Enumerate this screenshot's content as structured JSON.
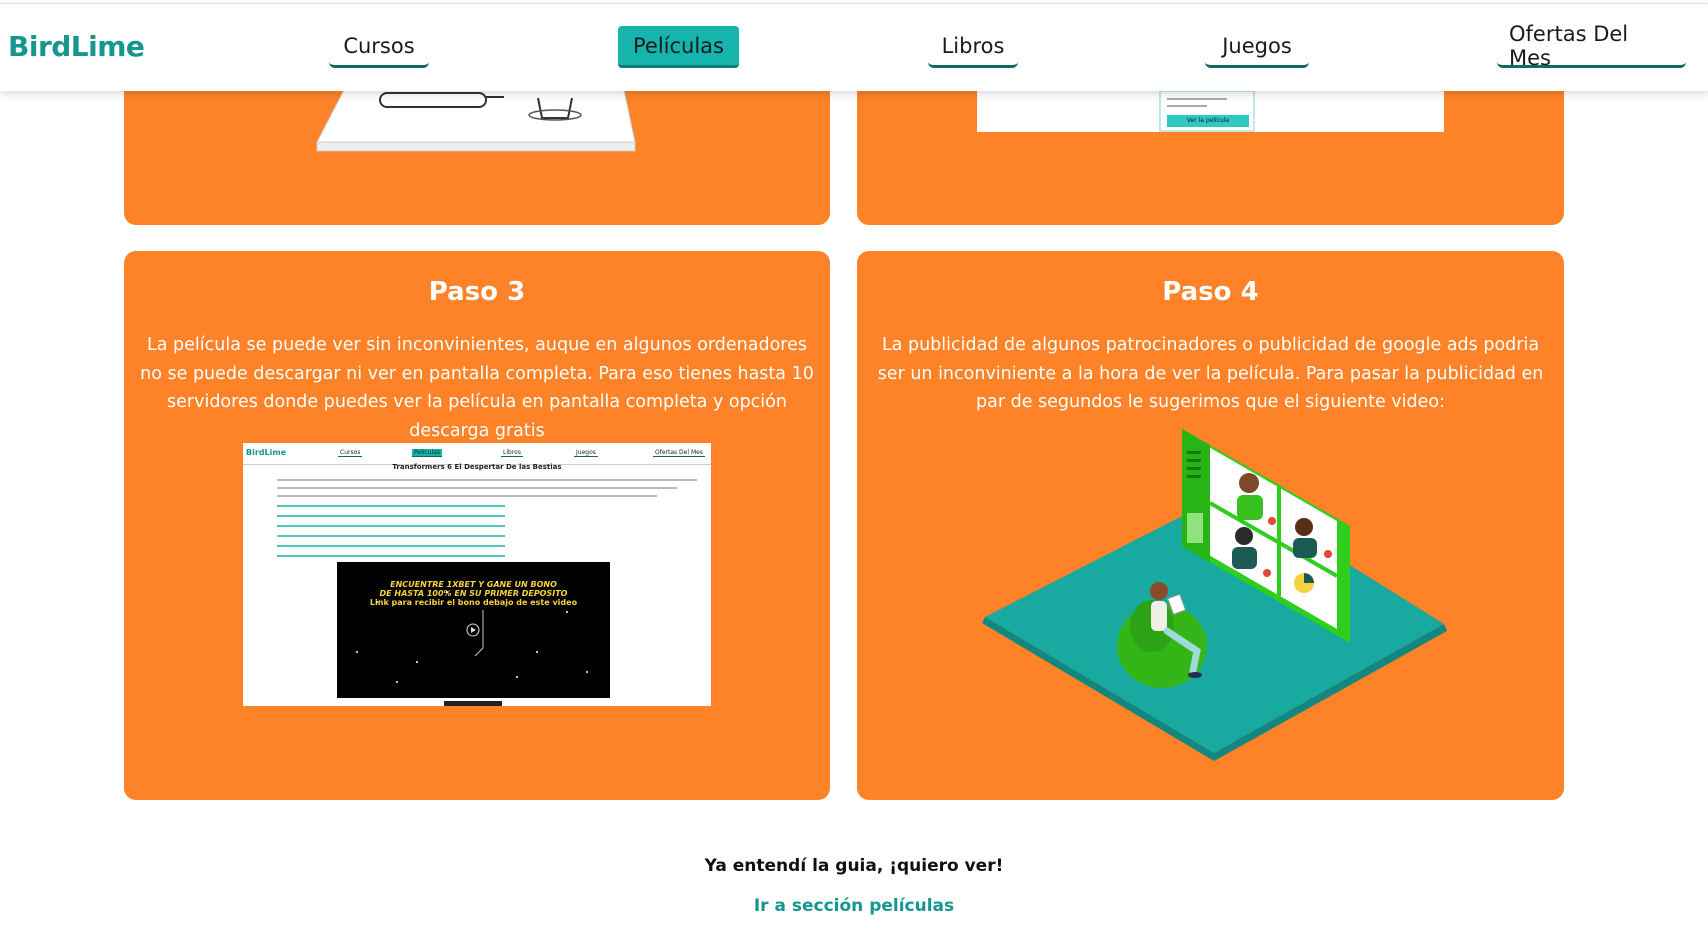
{
  "brand": "BirdLime",
  "nav": {
    "items": [
      {
        "label": "Cursos"
      },
      {
        "label": "Películas"
      },
      {
        "label": "Libros"
      },
      {
        "label": "Juegos"
      },
      {
        "label": "Ofertas Del Mes"
      }
    ],
    "active": "Películas"
  },
  "top_cards": {
    "right_mockup_text": "Ver la película"
  },
  "steps": [
    {
      "title": "Paso 3",
      "text": "La película se puede ver sin inconvinientes, auque en algunos ordenadores no se puede descargar ni ver en pantalla completa. Para eso tienes hasta 10 servidores donde puedes ver la película en pantalla completa y opción descarga gratis",
      "screenshot": {
        "brand": "BirdLime",
        "nav": [
          "Cursos",
          "Películas",
          "Libros",
          "Juegos",
          "Ofertas Del Mes"
        ],
        "heading": "Transformers 6 El Despertar De las Bestias",
        "promo_line1": "ENCUENTRE 1XBET Y GANE UN BONO",
        "promo_line2": "DE HASTA 100% EN SU PRIMER DEPOSITO",
        "promo_line3": "Link para recibir el bono debajo de este video"
      }
    },
    {
      "title": "Paso 4",
      "text": "La publicidad de algunos patrocinadores o publicidad de google ads podria ser un inconviniente a la hora de ver la película. Para pasar la publicidad en par de segundos le sugerimos que el siguiente video:"
    }
  ],
  "footer": {
    "cta_text": "Ya entendí la guia, ¡quiero ver!",
    "cta_link": "Ir a sección películas"
  },
  "colors": {
    "card": "#fd8228",
    "brand": "#15968f",
    "active_nav": "#15b5ad"
  }
}
